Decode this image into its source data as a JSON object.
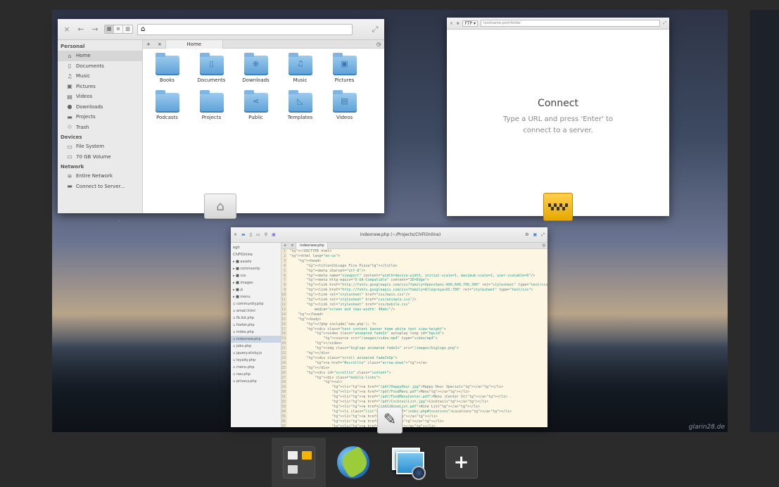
{
  "files": {
    "path": "",
    "tab_label": "Home",
    "sidebar": [
      {
        "type": "header",
        "label": "Personal"
      },
      {
        "type": "item",
        "icon": "home-icon",
        "glyph": "⌂",
        "label": "Home",
        "selected": true
      },
      {
        "type": "item",
        "icon": "document-icon",
        "glyph": "▯",
        "label": "Documents"
      },
      {
        "type": "item",
        "icon": "music-icon",
        "glyph": "♫",
        "label": "Music"
      },
      {
        "type": "item",
        "icon": "pictures-icon",
        "glyph": "▣",
        "label": "Pictures"
      },
      {
        "type": "item",
        "icon": "videos-icon",
        "glyph": "▤",
        "label": "Videos"
      },
      {
        "type": "item",
        "icon": "downloads-icon",
        "glyph": "●",
        "label": "Downloads"
      },
      {
        "type": "item",
        "icon": "projects-icon",
        "glyph": "▬",
        "label": "Projects"
      },
      {
        "type": "item",
        "icon": "trash-icon",
        "glyph": "♲",
        "label": "Trash"
      },
      {
        "type": "header",
        "label": "Devices"
      },
      {
        "type": "item",
        "icon": "filesystem-icon",
        "glyph": "▭",
        "label": "File System"
      },
      {
        "type": "item",
        "icon": "volume-icon",
        "glyph": "▭",
        "label": "70 GB Volume"
      },
      {
        "type": "header",
        "label": "Network"
      },
      {
        "type": "item",
        "icon": "network-icon",
        "glyph": "≋",
        "label": "Entire Network"
      },
      {
        "type": "item",
        "icon": "server-icon",
        "glyph": "▬",
        "label": "Connect to Server..."
      }
    ],
    "folders": [
      {
        "label": "Books",
        "glyph": ""
      },
      {
        "label": "Documents",
        "glyph": "▯"
      },
      {
        "label": "Downloads",
        "glyph": "⊕"
      },
      {
        "label": "Music",
        "glyph": "♫"
      },
      {
        "label": "Pictures",
        "glyph": "▣"
      },
      {
        "label": "Podcasts",
        "glyph": ""
      },
      {
        "label": "Projects",
        "glyph": ""
      },
      {
        "label": "Public",
        "glyph": "⋖"
      },
      {
        "label": "Templates",
        "glyph": "◺"
      },
      {
        "label": "Videos",
        "glyph": "▤"
      }
    ]
  },
  "connect": {
    "protocol": "FTP",
    "address_placeholder": "hostname:port/folder",
    "title": "Connect",
    "subtitle": "Type a URL and press 'Enter' to connect to a server."
  },
  "editor": {
    "title": "indexnew.php (~/Projects/ChiFiOnline)",
    "tab_label": "indexnew.php",
    "tree": [
      {
        "label": "egit",
        "sel": false
      },
      {
        "label": "ChiFiOnline",
        "sel": false
      },
      {
        "label": "▸ ■ assets",
        "sel": false
      },
      {
        "label": "▸ ■ community",
        "sel": false
      },
      {
        "label": "▸ ■ css",
        "sel": false
      },
      {
        "label": "▸ ■ images",
        "sel": false
      },
      {
        "label": "▸ ■ js",
        "sel": false
      },
      {
        "label": "▸ ■ menu",
        "sel": false
      },
      {
        "label": "▫ community.php",
        "sel": false
      },
      {
        "label": "▫ email.html",
        "sel": false
      },
      {
        "label": "▫ fb.list.php",
        "sel": false
      },
      {
        "label": "▫ footer.php",
        "sel": false
      },
      {
        "label": "▫ index.php",
        "sel": false
      },
      {
        "label": "▫ indexnew.php",
        "sel": true
      },
      {
        "label": "▫ jobs.php",
        "sel": false
      },
      {
        "label": "▫ jquery.sticky.js",
        "sel": false
      },
      {
        "label": "▫ loyalty.php",
        "sel": false
      },
      {
        "label": "▫ menu.php",
        "sel": false
      },
      {
        "label": "▫ nav.php",
        "sel": false
      },
      {
        "label": "▫ privacy.php",
        "sel": false
      }
    ],
    "code": [
      "<!DOCTYPE html>",
      "<html lang=\"en-us\">",
      "    <head>",
      "        <title>Chicago Fire Pizza</title>",
      "        <meta charset=\"utf-8\"/>",
      "        <meta name=\"viewport\" content=\"width=device-width, initial-scale=1, maximum-scale=1, user-scalable=0\"/>",
      "        <meta http-equiv=\"X-UA-Compatible\" content=\"IE=Edge\">",
      "        <link href=\"http://fonts.googleapis.com/css?family=Open+Sans:400,600,700,300\" rel=\"stylesheet\" type=\"text/css\">",
      "        <link href=\"http://fonts.googleapis.com/css?family=Allegreya+SC:700\" rel=\"stylesheet\" type=\"text/css\">",
      "        <link rel=\"stylesheet\" href=\"css/main.css\"/>",
      "        <link rel=\"stylesheet\" href=\"css/animate.css\"/>",
      "        <link rel=\"stylesheet\" href=\"css/mobile.css\"",
      "            media=\"screen and (max-width: 40em)\"/>",
      "    </head>",
      "    <body>",
      "        <?php include('nav.php'); ?>",
      "        <div class=\"text content banner home white text view-height\">",
      "            <video class=\"animated fadeIn\" autoplay loop id=\"bgvid\">",
      "                <source src=\"/images/video.mp4\" type=\"video/mp4\">",
      "            </video>",
      "            <img class=\"biglogo animated fadeIn\" src=\"/images/biglogo.png\">",
      "        </div>",
      "        <div class=\"scroll animated fadeInUp\">",
      "            <a href=\"#scrollto\" class=\"arrow-down\"></a>",
      "        </div>",
      "        <div id=\"scrollto\" class=\"content\">",
      "            <div class=\"mobile-links\">",
      "                <ul>",
      "                    <li><a href=\"/pdf/HappyHour.jpg\">Happy Hour Specials</a></li>",
      "                    <li><a href=\"/pdf/FoodMenu.pdf\">Menu</a></li>",
      "                    <li><a href=\"/pdf/FoodMenuCenter.pdf\">Menu (Center St)</a></li>",
      "                    <li><a href=\"/pdf/CocktailList.jpg\">Cocktails</a></li>",
      "                    <li><a href=\"/pdf/WineList.pdf\">Wine List</a></li>",
      "                    <li class=\"list\"><a href=\"index.php#locations\">Locations</a></li>",
      "                    <li><a href=\"/.\">Gift</a></li>",
      "                    <li><a href=\"/.\">Balance</a></li>",
      "                    <li><a href=\"/.\">Pay</a></li>"
    ]
  },
  "wallpaper_credit": "glarin28.de",
  "dock": [
    {
      "name": "dock-multitask",
      "label": "Multitasking View"
    },
    {
      "name": "dock-web",
      "label": "Web Browser"
    },
    {
      "name": "dock-photos",
      "label": "Photos"
    },
    {
      "name": "dock-add",
      "label": "New Workspace"
    }
  ]
}
